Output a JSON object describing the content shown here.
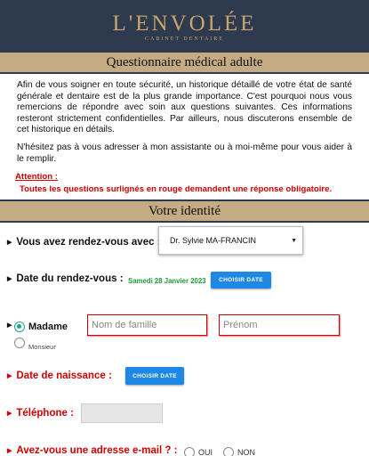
{
  "header": {
    "brand": "L'ENVOLÉE",
    "brand_sub": "CABINET DENTAIRE"
  },
  "title": "Questionnaire médical adulte",
  "intro": {
    "p1": "Afin de vous soigner en toute sécurité, un historique détaillé de votre état de santé générale et dentaire est de la plus grande importance. C'est pourquoi nous vous remercions de répondre avec soin aux questions suivantes. Ces informations resteront strictement confidentielles. Par ailleurs, nous discuterons ensemble de cet historique en détails.",
    "p2": "N'hésitez pas à vous adresser à mon assistante ou à moi-même pour vous aider à le remplir."
  },
  "attention": {
    "title": "Attention :",
    "note": "Toutes les questions surlignés en rouge demandent une réponse obligatoire."
  },
  "identity": {
    "section_title": "Votre identité",
    "appointment_with_label": "Vous avez rendez-vous avec :",
    "practitioner_selected": "Dr. Sylvie MA-FRANCIN",
    "appointment_date_label": "Date du rendez-vous :",
    "appointment_date_value": "Samedi 28 Janvier 2023",
    "choose_date_button": "CHOISIR DATE",
    "title_madame": "Madame",
    "title_monsieur": "Monsieur",
    "last_name_placeholder": "Nom de famille",
    "first_name_placeholder": "Prénom",
    "birth_date_label": "Date de naissance :",
    "phone_label": "Téléphone :",
    "email_question": "Avez-vous une adresse e-mail ? :",
    "option_yes": "OUI",
    "option_no": "NON"
  },
  "colors": {
    "header_bg": "#2e3a4e",
    "band_bg": "#c5ab83",
    "required_red": "#d20000",
    "button_blue": "#1e88e5",
    "date_green": "#1f9a3a",
    "radio_teal": "#1aa48a"
  },
  "icons": {
    "dropdown": "caret-down-icon",
    "bullet": "triangle-right-icon"
  }
}
